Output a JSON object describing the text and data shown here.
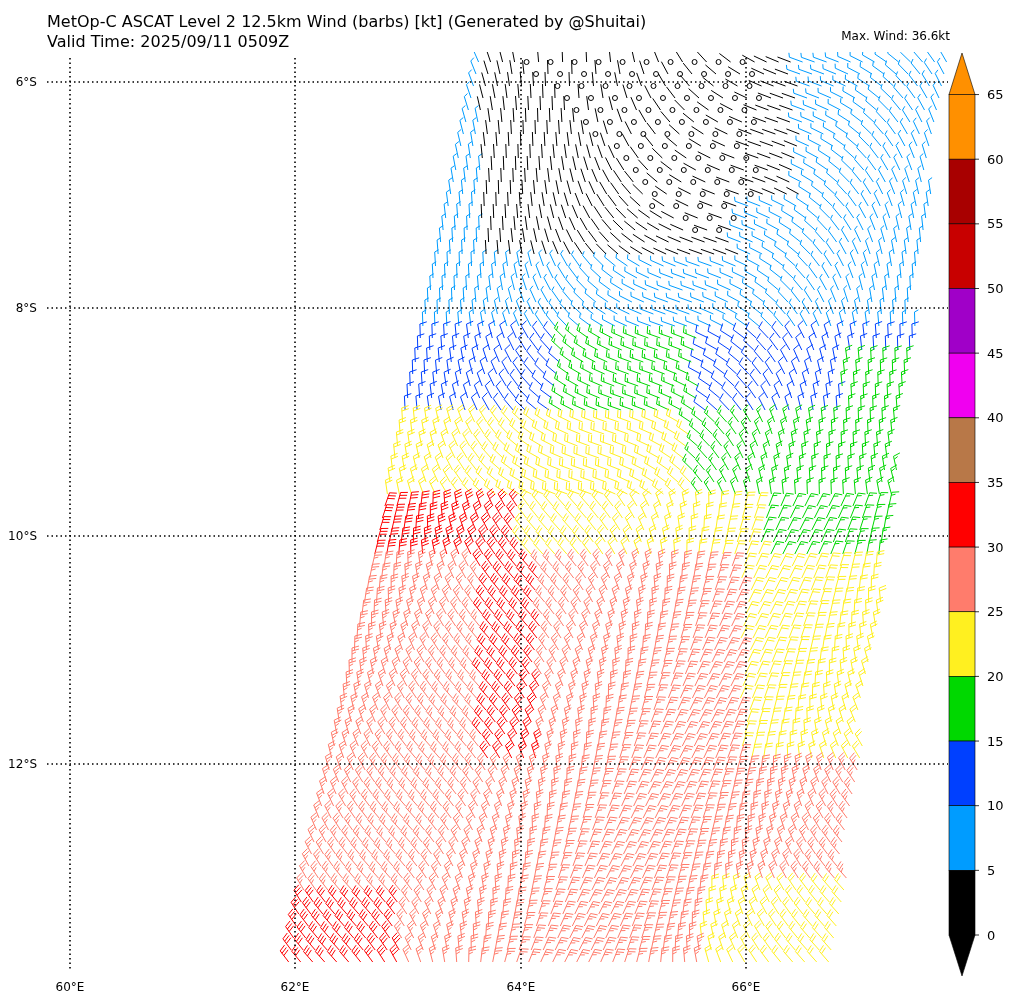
{
  "header": {
    "title": "MetOp-C ASCAT Level 2 12.5km Wind (barbs) [kt] (Generated by @Shuitai)",
    "subtitle": "Valid Time: 2025/09/11 0509Z",
    "max_wind": "Max. Wind: 36.6kt"
  },
  "map": {
    "lat_labels": [
      "6°S",
      "8°S",
      "10°S",
      "12°S"
    ],
    "lon_labels": [
      "60°E",
      "62°E",
      "64°E",
      "66°E"
    ]
  },
  "colorbar": {
    "bands": [
      {
        "kind": "triangle",
        "color": "#ff9000"
      },
      {
        "kind": "band",
        "color": "#ff9000"
      },
      {
        "kind": "band",
        "color": "#a80000"
      },
      {
        "kind": "band",
        "color": "#c80000"
      },
      {
        "kind": "band",
        "color": "#a000c8"
      },
      {
        "kind": "band",
        "color": "#f000f0"
      },
      {
        "kind": "band",
        "color": "#b87848"
      },
      {
        "kind": "band",
        "color": "#ff0000"
      },
      {
        "kind": "band",
        "color": "#ff7c6c"
      },
      {
        "kind": "band",
        "color": "#fff020"
      },
      {
        "kind": "band",
        "color": "#00d800"
      },
      {
        "kind": "band",
        "color": "#0040ff"
      },
      {
        "kind": "band",
        "color": "#009cff"
      },
      {
        "kind": "band",
        "color": "#000000"
      },
      {
        "kind": "triangle",
        "color": "#000000"
      }
    ],
    "ticks": [
      "65",
      "60",
      "55",
      "50",
      "45",
      "40",
      "35",
      "30",
      "25",
      "20",
      "15",
      "10",
      "5",
      "0"
    ]
  }
}
